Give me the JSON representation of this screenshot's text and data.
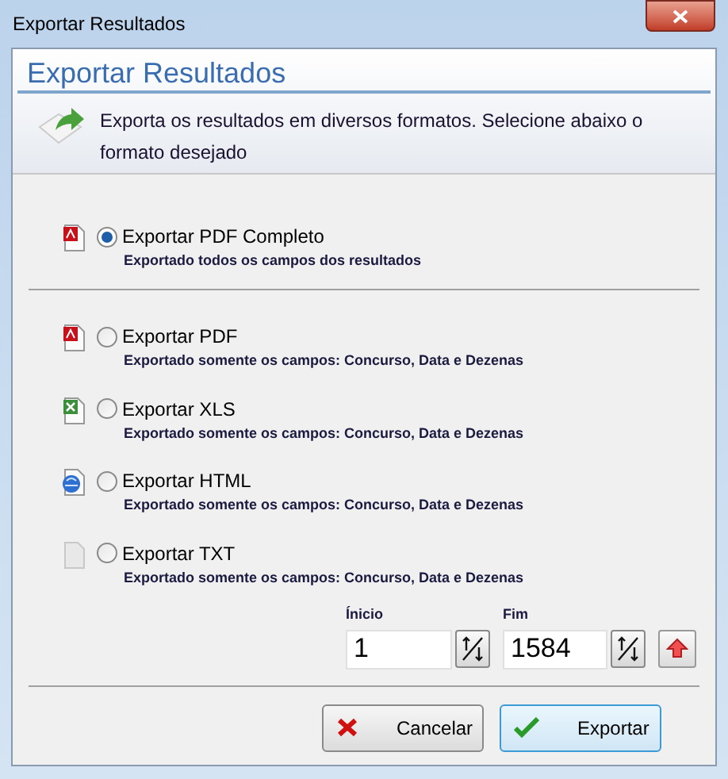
{
  "window": {
    "title": "Exportar Resultados"
  },
  "header": {
    "title": "Exportar Resultados",
    "description": "Exporta os resultados em diversos formatos. Selecione abaixo o formato desejado"
  },
  "main_option": {
    "kind": "pdf",
    "label": "Exportar PDF Completo",
    "note": "Exportado todos os campos dos resultados",
    "selected": true
  },
  "options": [
    {
      "kind": "pdf",
      "label": "Exportar PDF",
      "note": "Exportado somente os campos: Concurso, Data e Dezenas",
      "selected": false
    },
    {
      "kind": "xls",
      "label": "Exportar XLS",
      "note": "Exportado somente os campos: Concurso, Data e Dezenas",
      "selected": false
    },
    {
      "kind": "html",
      "label": "Exportar HTML",
      "note": "Exportado somente os campos: Concurso, Data e Dezenas",
      "selected": false
    },
    {
      "kind": "txt",
      "label": "Exportar TXT",
      "note": "Exportado somente os campos: Concurso, Data e Dezenas",
      "selected": false
    }
  ],
  "range": [
    {
      "label": "Ínicio",
      "value": "1"
    },
    {
      "label": "Fim",
      "value": "1584"
    }
  ],
  "buttons": [
    {
      "kind": "cancel",
      "label": "Cancelar"
    },
    {
      "kind": "export",
      "label": "Exportar"
    }
  ]
}
